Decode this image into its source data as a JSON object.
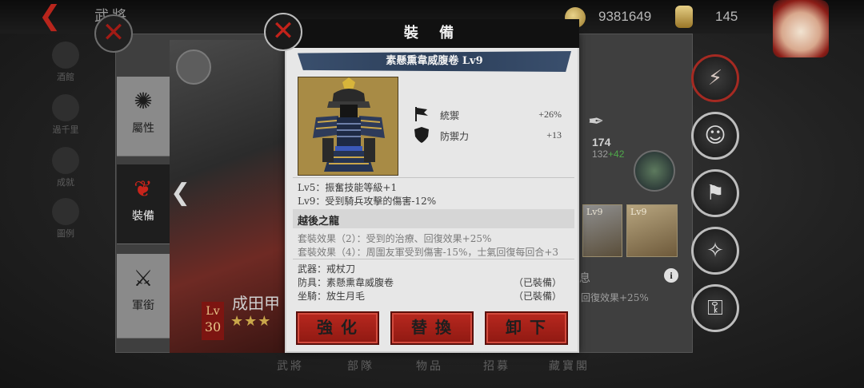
{
  "top_bar": {
    "gold": "9381649",
    "tokens": "145",
    "ghost_title": "武將"
  },
  "left_nav": [
    {
      "label": "酒館",
      "icon": "sake-icon"
    },
    {
      "label": "過千里",
      "icon": "scroll-map-icon"
    },
    {
      "label": "成就",
      "icon": "trophy-icon"
    },
    {
      "label": "圖例",
      "icon": "question-icon"
    }
  ],
  "side_tabs": [
    {
      "label": "屬性",
      "icon": "swirl-icon",
      "glyph": "✺"
    },
    {
      "label": "裝備",
      "icon": "fan-icon",
      "glyph": "❦"
    },
    {
      "label": "軍銜",
      "icon": "crossed-swords-icon",
      "glyph": "⚔"
    }
  ],
  "hero": {
    "lv_label": "Lv",
    "lv_value": "30",
    "name": "成田甲",
    "stars": "★★★"
  },
  "right_stats": {
    "total": "174",
    "base": "132",
    "bonus": "+42",
    "horse_lv": "Lv9",
    "book_lv": "Lv9",
    "ghost_set_effect": "回復效果+25%",
    "ghost_char": "息"
  },
  "bottom_nav": [
    "武將",
    "部隊",
    "物品",
    "招募",
    "藏寶閣"
  ],
  "dialog": {
    "title": "裝 備",
    "item_name": "素懸熏韋威腹卷 Lv9",
    "stats": [
      {
        "name": "統禦",
        "value": "+26%",
        "icon": "banner-icon"
      },
      {
        "name": "防禦力",
        "value": "+13",
        "icon": "shield-icon"
      }
    ],
    "level_effects": [
      "Lv5：振奮技能等級+1",
      "Lv9：受到騎兵攻擊的傷害-12%"
    ],
    "set_name": "越後之龍",
    "set_effects": [
      "套裝效果（2）：受到的治療、回復效果+25%",
      "套裝效果（4）：周圍友軍受到傷害-15%，士氣回復每回合+3"
    ],
    "set_members": [
      {
        "slot": "武器：戒杖刀",
        "state": ""
      },
      {
        "slot": "防具：素懸熏韋威腹卷",
        "state": "（已裝備）"
      },
      {
        "slot": "坐騎：放生月毛",
        "state": "（已裝備）"
      }
    ],
    "buttons": {
      "enhance": "強化",
      "replace": "替換",
      "unequip": "卸下"
    }
  },
  "colors": {
    "accent_red": "#b8281f",
    "banner_blue": "#2c3f5a",
    "bonus_green": "#4fa84a",
    "panel": "#e7e7e7"
  }
}
